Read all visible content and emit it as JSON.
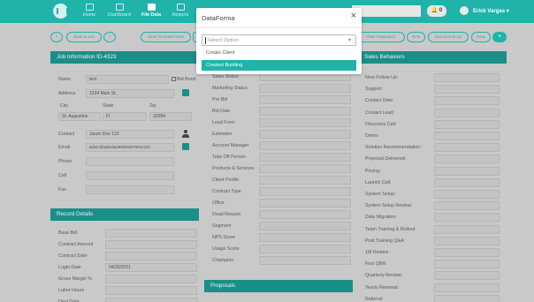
{
  "colors": {
    "accent": "#1fb3aa",
    "panel_header": "#1a8f88",
    "overlay_bg": "#c9c9c9"
  },
  "nav": {
    "items": [
      {
        "label": "Home",
        "icon": "home-icon"
      },
      {
        "label": "Dashboard",
        "icon": "dashboard-icon"
      },
      {
        "label": "File Data",
        "icon": "file-data-icon",
        "active": true
      },
      {
        "label": "Reports",
        "icon": "reports-icon"
      }
    ],
    "notification_count": "0",
    "user_name": "Erick Vargas"
  },
  "toolbar": {
    "back": "‹",
    "back_to_list": "Back to List",
    "forward": "›",
    "send_to_dataforma": "Send To DataForma",
    "chief_integration": "Chief Integration",
    "new": "New",
    "documents": "Documents (0)",
    "save": "Save",
    "add": "+"
  },
  "job_info": {
    "header": "Job Information ID-4323",
    "name_label": "Name",
    "name_value": "test",
    "bid_bond_label": "Bid Bond",
    "address_label": "Address",
    "address_value": "1234 Main St.",
    "city_label": "City",
    "state_label": "State",
    "zip_label": "Zip",
    "city_value": "St. Augustine",
    "state_value": "Fl",
    "zip_value": "32084",
    "contact_label": "Contact",
    "contact_value": "Jason Doe 122",
    "email_label": "Email",
    "email_value": "admin@a83edad905084976061233",
    "phone_label": "Phone",
    "cell_label": "Cell",
    "fax_label": "Fax"
  },
  "record_details": {
    "header": "Record Details",
    "rows": [
      {
        "label": "Base Bid",
        "value": ""
      },
      {
        "label": "Contract Amount",
        "value": ""
      },
      {
        "label": "Contract Date",
        "value": ""
      },
      {
        "label": "Login Date",
        "value": "04/20/2021"
      },
      {
        "label": "Gross Margin %",
        "value": ""
      },
      {
        "label": "Labor Hours",
        "value": ""
      },
      {
        "label": "Deal Date",
        "value": ""
      }
    ]
  },
  "middle": {
    "rows": [
      "Sales Status",
      "Marketing Status",
      "Pre Bid",
      "Bid Date",
      "Lead From",
      "Estimator",
      "Account Manager",
      "Take Off Person",
      "Products & Services",
      "Client Profile",
      "Contract Type",
      "Office",
      "Dead Reason",
      "Segment",
      "NPS Score",
      "Usage Score",
      "Champion"
    ],
    "proposals_header": "Proposals"
  },
  "sales": {
    "header": "Sales Behaviors",
    "rows": [
      "Next Follow Up:",
      "Support:",
      "Contact Date:",
      "Contact Lead:",
      "Discovery Call:",
      "Demo:",
      "Solution Recommendation:",
      "Proposal Delivered:",
      "Pricing:",
      "Launch Call:",
      "System Setup:",
      "System Setup Review:",
      "Data Migration:",
      "Team Training & Rollout:",
      "Post Training Q&A:",
      "1M Review :",
      "First QBR:",
      "Quarterly Review:",
      "Yearly Renewal:",
      "Referral:"
    ]
  },
  "modal": {
    "title": "DataForma",
    "close": "×",
    "placeholder": "Select Option",
    "options": [
      {
        "label": "Create Client",
        "selected": false
      },
      {
        "label": "Created Building",
        "selected": true
      }
    ]
  }
}
